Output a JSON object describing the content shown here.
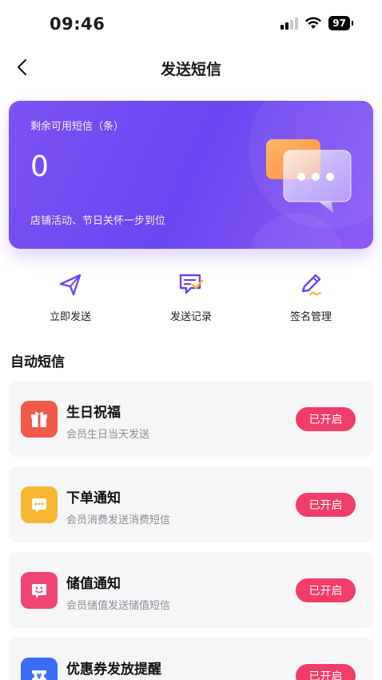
{
  "status_bar": {
    "time": "09:46",
    "battery": "97"
  },
  "nav": {
    "title": "发送短信"
  },
  "credit_card": {
    "label": "剩余可用短信（条）",
    "count": "0",
    "subtitle": "店铺活动、节日关怀一步到位"
  },
  "quick_actions": [
    {
      "label": "立即发送",
      "icon": "send-icon"
    },
    {
      "label": "发送记录",
      "icon": "record-icon"
    },
    {
      "label": "签名管理",
      "icon": "pen-icon"
    }
  ],
  "section": {
    "title": "自动短信"
  },
  "auto_sms": [
    {
      "title": "生日祝福",
      "desc": "会员生日当天发送",
      "status": "已开启",
      "icon": "gift-icon",
      "color": "#f05a4a"
    },
    {
      "title": "下单通知",
      "desc": "会员消费发送消费短信",
      "status": "已开启",
      "icon": "chat-icon",
      "color": "#f7b733"
    },
    {
      "title": "储值通知",
      "desc": "会员储值发送储值短信",
      "status": "已开启",
      "icon": "smile-chat-icon",
      "color": "#f04673"
    },
    {
      "title": "优惠券发放提醒",
      "desc": "",
      "status": "已开启",
      "icon": "coupon-icon",
      "color": "#3b6cf5"
    }
  ],
  "colors": {
    "accent": "#6a46f0",
    "pill": "#f23d6a"
  }
}
